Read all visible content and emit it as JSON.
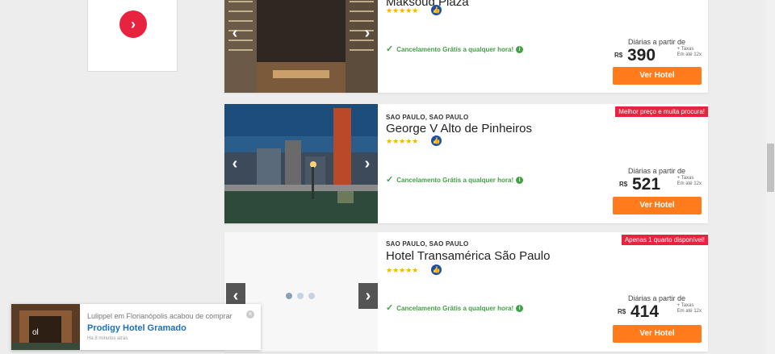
{
  "side_card": {
    "arrow_icon": "chevron-right-icon"
  },
  "hotels": [
    {
      "city": "",
      "name": "Maksoud Plaza",
      "stars": "★★★★★",
      "cancel": "Cancelamento Grátis a qualquer hora!",
      "badge": "",
      "price_label": "Diárias a partir de",
      "currency": "R$",
      "amount": "390",
      "tax_line1": "+ Taxas",
      "tax_line2": "Em até 12x",
      "button": "Ver Hotel"
    },
    {
      "city": "SAO PAULO, SAO PAULO",
      "name": "George V Alto de Pinheiros",
      "stars": "★★★★★",
      "cancel": "Cancelamento Grátis a qualquer hora!",
      "badge": "Melhor preço e muita procura!",
      "price_label": "Diárias a partir de",
      "currency": "R$",
      "amount": "521",
      "tax_line1": "+ Taxas",
      "tax_line2": "Em até 12x",
      "button": "Ver Hotel"
    },
    {
      "city": "SAO PAULO, SAO PAULO",
      "name": "Hotel Transamérica São Paulo",
      "stars": "★★★★★",
      "cancel": "Cancelamento Grátis a qualquer hora!",
      "badge": "Apenas 1 quarto disponível!",
      "price_label": "Diárias a partir de",
      "currency": "R$",
      "amount": "414",
      "tax_line1": "+ Taxas",
      "tax_line2": "Em até 12x",
      "button": "Ver Hotel"
    }
  ],
  "notification": {
    "line1": "Lulippel em Florianópolis acabou de comprar",
    "hotel": "Prodigy Hotel Gramado",
    "time": "Há 8 minutos atrás",
    "close_icon": "close-icon"
  },
  "colors": {
    "accent": "#e8233f",
    "button": "#ff7b1c",
    "success": "#43a047",
    "link": "#1f6fb5"
  }
}
